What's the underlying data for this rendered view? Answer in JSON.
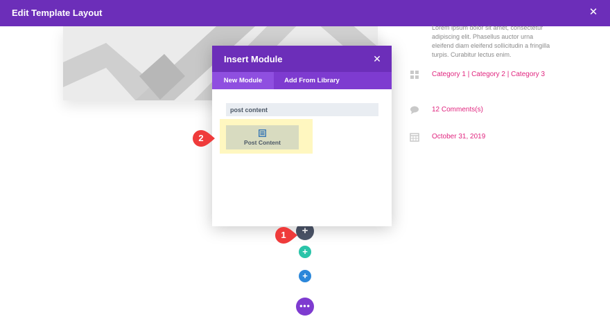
{
  "topbar": {
    "title": "Edit Template Layout",
    "close_icon": "close-icon",
    "color": "#6c2eb9"
  },
  "post_meta": {
    "excerpt": "Lorem ipsum dolor sit amet, consectetur adipiscing elit. Phasellus auctor urna eleifend diam eleifend sollicitudin a fringilla turpis. Curabitur lectus enim.",
    "categories": "Category 1 | Category 2 | Category 3",
    "comments": "12 Comments(s)",
    "date": "October 31, 2019",
    "link_color": "#e0247e"
  },
  "modal": {
    "title": "Insert Module",
    "tabs": [
      {
        "label": "New Module",
        "active": true
      },
      {
        "label": "Add From Library",
        "active": false
      }
    ],
    "search": {
      "value": "post content",
      "placeholder": ""
    },
    "modules": [
      {
        "label": "Post Content",
        "icon": "post-content-icon"
      }
    ]
  },
  "builder_buttons": {
    "add_module": "+",
    "add_row": "+",
    "add_section": "+",
    "more_options": "•••"
  },
  "callouts": {
    "first": "1",
    "second": "2",
    "color": "#ef3b3b"
  }
}
